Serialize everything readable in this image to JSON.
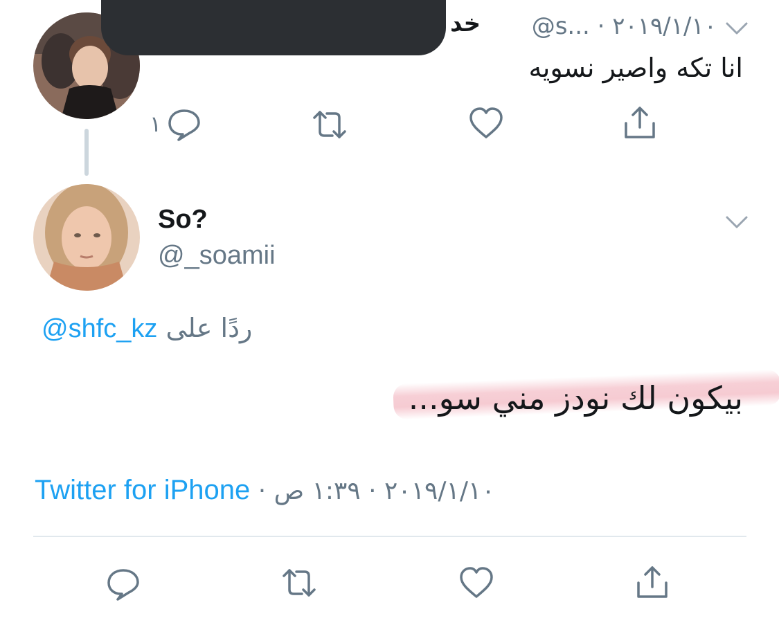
{
  "parent_tweet": {
    "name": "خد",
    "handle_time": "@s... · ٢٠١٩/١/١٠",
    "text": "انا تكه واصير نسويه",
    "reply_count": "١"
  },
  "reply_tweet": {
    "name": "So?",
    "handle": "@_soamii",
    "replying_to_label": "ردًا على",
    "replying_to_handle": "@shfc_kz",
    "text": "بيكون لك نودز مني سو...",
    "source": "Twitter for iPhone",
    "meta": " · ٢٠١٩/١/١٠ · ١:٣٩ ص"
  },
  "icons": {
    "reply": "reply-icon",
    "retweet": "retweet-icon",
    "like": "heart-icon",
    "share": "share-icon",
    "caret": "chevron-down-icon"
  },
  "colors": {
    "link": "#1da1f2",
    "secondary_text": "#657786",
    "icon": "#657786",
    "highlight": "#f0a8b4"
  }
}
